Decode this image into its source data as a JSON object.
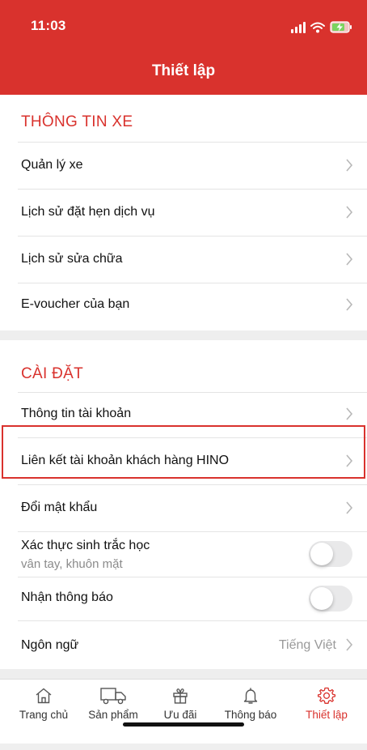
{
  "status_bar": {
    "time": "11:03"
  },
  "header": {
    "title": "Thiết lập"
  },
  "sections": {
    "vehicle": {
      "heading": "THÔNG TIN XE",
      "items": [
        {
          "label": "Quản lý xe"
        },
        {
          "label": "Lịch sử đặt hẹn dịch vụ"
        },
        {
          "label": "Lịch sử sửa chữa"
        },
        {
          "label": "E-voucher của bạn"
        }
      ]
    },
    "settings": {
      "heading": "CÀI ĐẶT",
      "items": [
        {
          "label": "Thông tin tài khoản"
        },
        {
          "label": "Liên kết tài khoản khách hàng HINO"
        },
        {
          "label": "Đổi mật khẩu"
        },
        {
          "label": "Xác thực sinh trắc học",
          "sublabel": "vân tay, khuôn mặt",
          "toggle_on": false
        },
        {
          "label": "Nhận thông báo",
          "toggle_on": false
        },
        {
          "label": "Ngôn ngữ",
          "value": "Tiếng Việt"
        }
      ]
    }
  },
  "tabbar": {
    "items": [
      {
        "label": "Trang chủ",
        "icon": "home-icon"
      },
      {
        "label": "Sản phẩm",
        "icon": "truck-icon"
      },
      {
        "label": "Ưu đãi",
        "icon": "gift-icon"
      },
      {
        "label": "Thông báo",
        "icon": "bell-icon"
      },
      {
        "label": "Thiết lập",
        "icon": "gear-icon",
        "active": true
      }
    ]
  },
  "colors": {
    "brand_red": "#d9322d",
    "divider": "#e4e4e4",
    "section_gap": "#eeeeee",
    "muted_text": "#8b8b8b"
  }
}
